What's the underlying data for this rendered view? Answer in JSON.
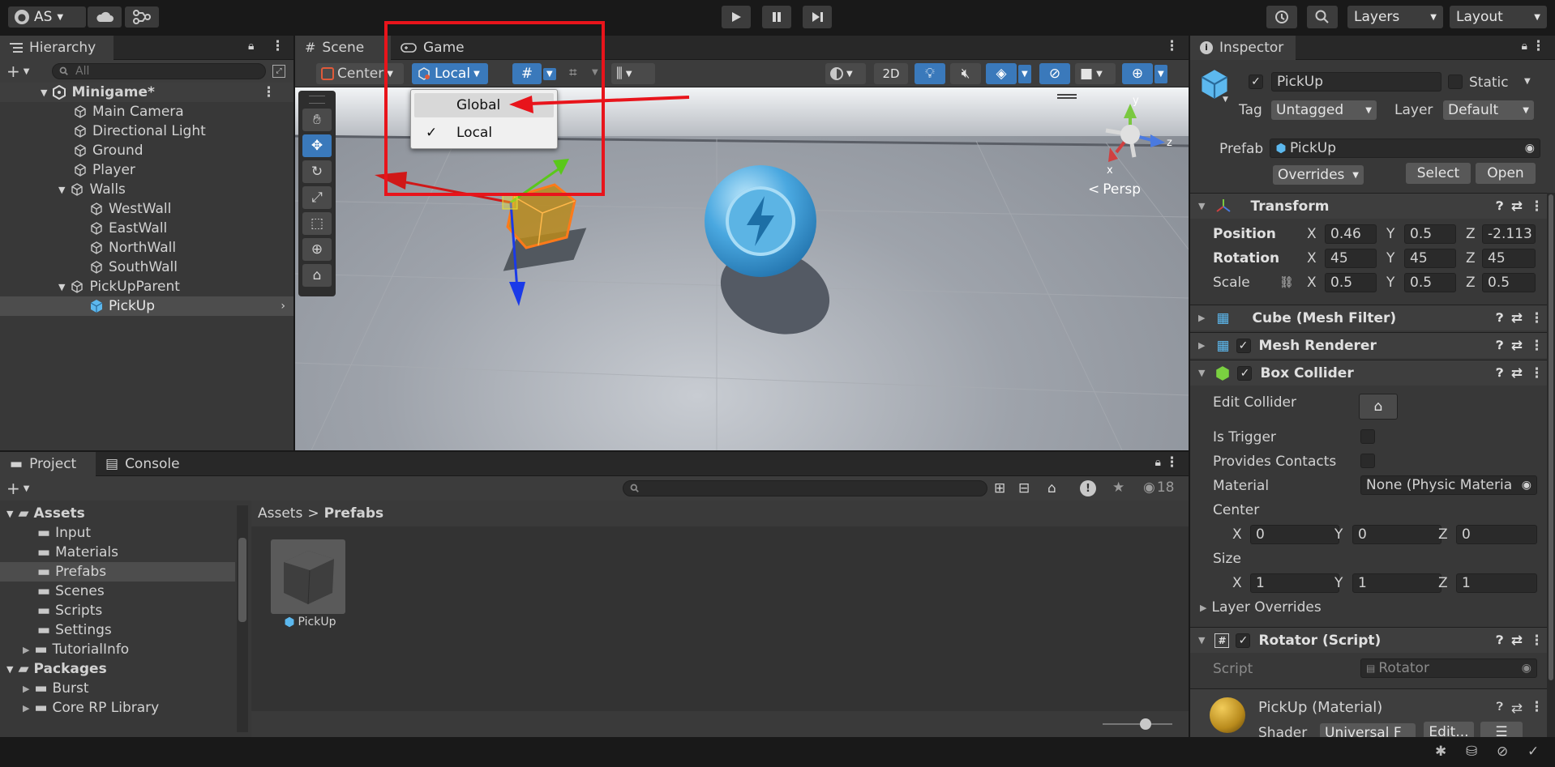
{
  "toolbar": {
    "account_label": "AS",
    "layers_label": "Layers",
    "layout_label": "Layout"
  },
  "hierarchy": {
    "tab_label": "Hierarchy",
    "search_placeholder": "All",
    "scene_name": "Minigame*",
    "items": {
      "main_camera": "Main Camera",
      "directional_light": "Directional Light",
      "ground": "Ground",
      "player": "Player",
      "walls": "Walls",
      "west_wall": "WestWall",
      "east_wall": "EastWall",
      "north_wall": "NorthWall",
      "south_wall": "SouthWall",
      "pickup_parent": "PickUpParent",
      "pickup": "PickUp"
    }
  },
  "scene": {
    "tabs": {
      "scene": "Scene",
      "game": "Game"
    },
    "pivot_label": "Center",
    "space_label": "Local",
    "mode_2d_label": "2D",
    "persp_label": "Persp",
    "gizmo_axes": {
      "x": "x",
      "y": "y",
      "z": "z"
    },
    "dropdown": {
      "global": "Global",
      "local": "Local",
      "check_mark": "✓"
    }
  },
  "project": {
    "tabs": {
      "project": "Project",
      "console": "Console"
    },
    "hidden_count": "18",
    "breadcrumb": {
      "root": "Assets",
      "separator": ">",
      "current": "Prefabs"
    },
    "tree": {
      "assets": "Assets",
      "input": "Input",
      "materials": "Materials",
      "prefabs": "Prefabs",
      "scenes": "Scenes",
      "scripts": "Scripts",
      "settings": "Settings",
      "tutorial_info": "TutorialInfo",
      "packages": "Packages",
      "burst": "Burst",
      "core_rp": "Core RP Library"
    },
    "asset_name": "PickUp"
  },
  "inspector": {
    "tab_label": "Inspector",
    "object_name": "PickUp",
    "static_label": "Static",
    "tag_label": "Tag",
    "tag_value": "Untagged",
    "layer_label": "Layer",
    "layer_value": "Default",
    "prefab_label": "Prefab",
    "prefab_value": "PickUp",
    "overrides_label": "Overrides",
    "select_label": "Select",
    "open_label": "Open",
    "transform": {
      "title": "Transform",
      "position_label": "Position",
      "rotation_label": "Rotation",
      "scale_label": "Scale",
      "axis_x": "X",
      "axis_y": "Y",
      "axis_z": "Z",
      "position": {
        "x": "0.46",
        "y": "0.5",
        "z": "-2.113"
      },
      "rotation": {
        "x": "45",
        "y": "45",
        "z": "45"
      },
      "scale": {
        "x": "0.5",
        "y": "0.5",
        "z": "0.5"
      }
    },
    "mesh_filter_title": "Cube (Mesh Filter)",
    "mesh_renderer_title": "Mesh Renderer",
    "box_collider": {
      "title": "Box Collider",
      "edit_collider": "Edit Collider",
      "is_trigger": "Is Trigger",
      "provides_contacts": "Provides Contacts",
      "material_label": "Material",
      "material_value": "None (Physic Materia",
      "center_label": "Center",
      "size_label": "Size",
      "center": {
        "x": "0",
        "y": "0",
        "z": "0"
      },
      "size": {
        "x": "1",
        "y": "1",
        "z": "1"
      },
      "layer_overrides": "Layer Overrides"
    },
    "rotator": {
      "title": "Rotator (Script)",
      "script_label": "Script",
      "script_value": "Rotator"
    },
    "material": {
      "title": "PickUp (Material)",
      "shader_label": "Shader",
      "shader_value": "Universal F",
      "edit_label": "Edit..."
    }
  },
  "colors": {
    "accent_blue": "#3a79bb",
    "highlight_red": "#e8141b",
    "pickup_cube": "#5cb8ee"
  }
}
